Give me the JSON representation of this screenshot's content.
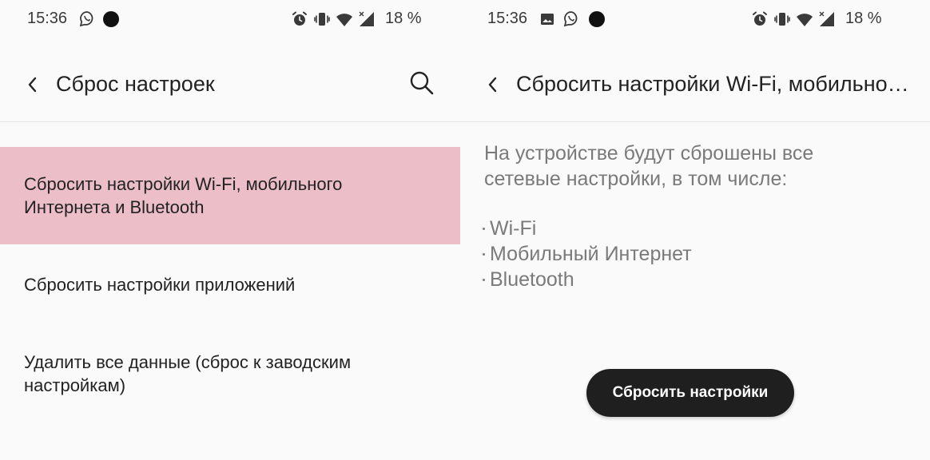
{
  "left": {
    "status": {
      "time": "15:36",
      "battery": "18 %"
    },
    "appbar": {
      "title": "Сброс настроек"
    },
    "items": [
      {
        "line1": "Сбросить настройки Wi-Fi, мобильного",
        "line2": "Интернета и Bluetooth"
      },
      {
        "line1": "Сбросить настройки приложений"
      },
      {
        "line1": "Удалить все данные (сброс к заводским",
        "line2": "настройкам)"
      }
    ]
  },
  "right": {
    "status": {
      "time": "15:36",
      "battery": "18 %"
    },
    "appbar": {
      "title": "Сбросить настройки Wi-Fi, мобильного…"
    },
    "description": {
      "line1": "На устройстве будут сброшены все",
      "line2": "сетевые настройки, в том числе:"
    },
    "bullets": [
      "Wi-Fi",
      "Мобильный Интернет",
      "Bluetooth"
    ],
    "button_label": "Сбросить настройки"
  },
  "colors": {
    "selected_bg": "#ebbec8",
    "button_bg": "#1f1f1f",
    "secondary_text": "#7a7a7a"
  },
  "icons": [
    "viber-icon",
    "notification-dot-icon",
    "alarm-icon",
    "vibrate-icon",
    "wifi-icon",
    "signal-icon",
    "image-icon",
    "back-arrow-icon",
    "search-icon"
  ]
}
